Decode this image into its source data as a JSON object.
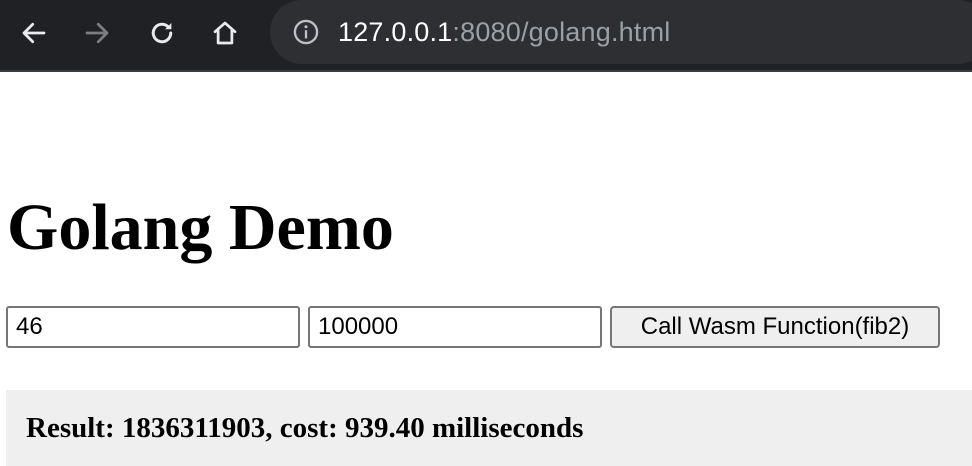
{
  "browser": {
    "url_host": "127.0.0.1",
    "url_path": ":8080/golang.html",
    "icons": {
      "back": "back-arrow-icon",
      "forward": "forward-arrow-icon",
      "reload": "reload-icon",
      "home": "home-icon",
      "info": "info-icon"
    }
  },
  "page": {
    "title": "Golang Demo",
    "n_value": "46",
    "iterations_value": "100000",
    "button_label": "Call Wasm Function(fib2)",
    "result_text": "Result: 1836311903, cost: 939.40 milliseconds"
  }
}
